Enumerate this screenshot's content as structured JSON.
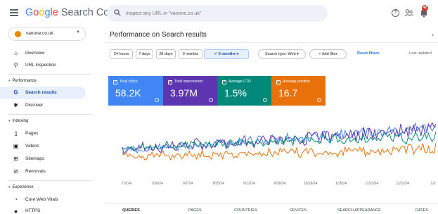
{
  "header": {
    "brand": {
      "google": "Google",
      "product": "Search Console"
    },
    "search_placeholder": "Inspect any URL in \"vanone.co.uk\"",
    "notification_count": "42"
  },
  "sidebar": {
    "property": "vanone.co.uk",
    "top_items": [
      {
        "label": "Overview",
        "icon": "home-icon"
      },
      {
        "label": "URL inspection",
        "icon": "search-icon"
      }
    ],
    "sections": [
      {
        "title": "Performance",
        "items": [
          {
            "label": "Search results",
            "icon": "google-g-icon",
            "active": true
          },
          {
            "label": "Discover",
            "icon": "asterisk-icon"
          }
        ]
      },
      {
        "title": "Indexing",
        "items": [
          {
            "label": "Pages",
            "icon": "pages-icon"
          },
          {
            "label": "Videos",
            "icon": "video-icon"
          },
          {
            "label": "Sitemaps",
            "icon": "sitemap-icon"
          },
          {
            "label": "Removals",
            "icon": "removals-icon"
          }
        ]
      },
      {
        "title": "Experience",
        "items": [
          {
            "label": "Core Web Vitals",
            "icon": "gauge-icon"
          },
          {
            "label": "HTTPS",
            "icon": "lock-icon"
          }
        ]
      }
    ]
  },
  "main": {
    "title": "Performance on Search results",
    "date_ranges": [
      "24 hours",
      "7 days",
      "28 days",
      "3 months",
      "6 months"
    ],
    "selected_range": "6 months",
    "search_type": "Search type: Web",
    "add_filter": "Add filter",
    "reset_filters": "Reset filters",
    "last_updated": "Last updated",
    "metrics": [
      {
        "label": "Total clicks",
        "value": "58.2K",
        "color": "#4285f4"
      },
      {
        "label": "Total impressions",
        "value": "3.97M",
        "color": "#5e35b1"
      },
      {
        "label": "Average CTR",
        "value": "1.5%",
        "color": "#00897b"
      },
      {
        "label": "Average position",
        "value": "16.7",
        "color": "#e8710a"
      }
    ],
    "tabs": [
      "QUERIES",
      "PAGES",
      "COUNTRIES",
      "DEVICES",
      "SEARCH APPEARANCE",
      "DATES"
    ],
    "active_tab": "QUERIES"
  },
  "chart_data": {
    "type": "line",
    "x_tick_labels": [
      "7/2/24",
      "7/20/24",
      "8/7/24",
      "8/25/24",
      "9/12/24",
      "9/30/24",
      "10/18/24",
      "11/5/24",
      "11/23/24",
      "12/11/24",
      "12/"
    ],
    "grid": false,
    "series": [
      {
        "name": "Total clicks",
        "color": "#4285f4"
      },
      {
        "name": "Total impressions",
        "color": "#5e35b1"
      },
      {
        "name": "Average CTR",
        "color": "#00897b"
      },
      {
        "name": "Average position",
        "color": "#e8710a"
      }
    ]
  }
}
